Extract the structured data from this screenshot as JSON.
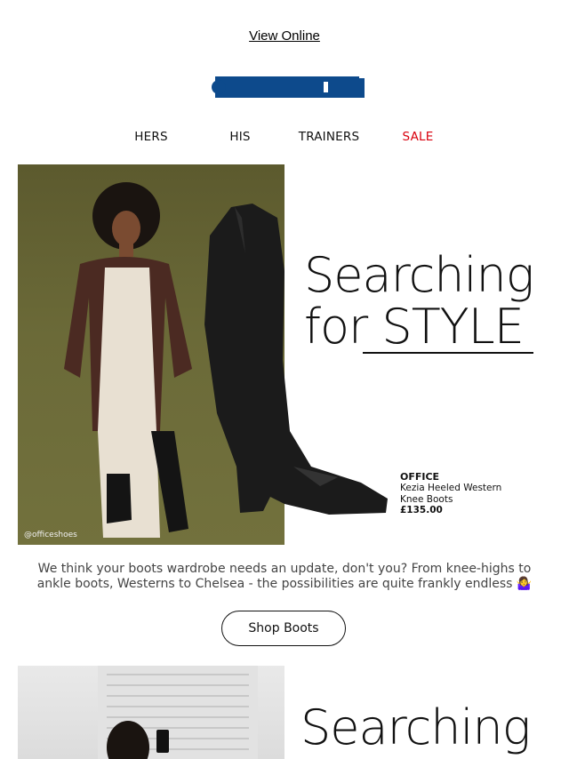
{
  "header": {
    "view_online": "View Online",
    "brand": "OFFICE"
  },
  "nav": {
    "items": [
      {
        "label": "HERS"
      },
      {
        "label": "HIS"
      },
      {
        "label": "TRAINERS"
      },
      {
        "label": "SALE"
      }
    ],
    "sale_color": "#d9000d"
  },
  "hero": {
    "headline_line1": "Searching",
    "headline_line2": "for STYLE",
    "instagram_handle": "@officeshoes",
    "product": {
      "brand": "OFFICE",
      "name_line1": "Kezia Heeled Western",
      "name_line2": "Knee Boots",
      "price": "£135.00"
    }
  },
  "body_copy": "We think your boots wardrobe needs an update, don't you? From knee-highs to ankle boots, Westerns to Chelsea - the possibilities are quite frankly endless 🤷‍♀️",
  "cta": {
    "shop_boots": "Shop Boots"
  },
  "hero2": {
    "headline_line1": "Searching"
  },
  "colors": {
    "brand_blue": "#0d4a8c",
    "text": "#111111",
    "olive_bg": "#6b6a38"
  }
}
